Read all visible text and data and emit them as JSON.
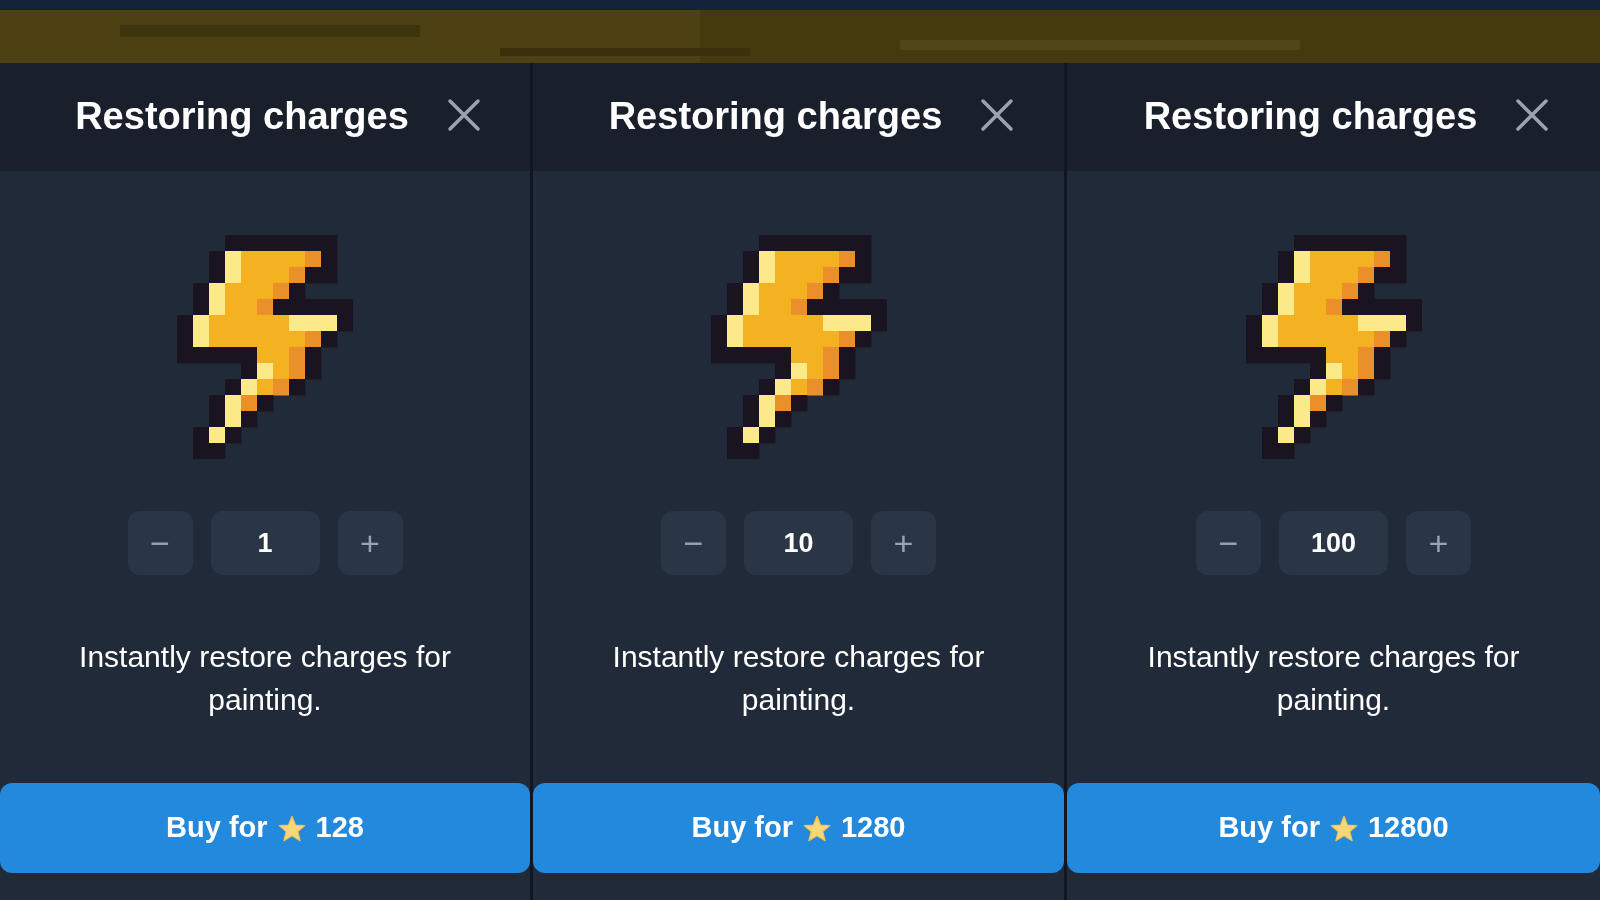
{
  "panels": [
    {
      "title": "Restoring charges",
      "decrement": "−",
      "quantity": "1",
      "increment": "+",
      "description": "Instantly restore charges for painting.",
      "buy_label": "Buy for",
      "price": "128"
    },
    {
      "title": "Restoring charges",
      "decrement": "−",
      "quantity": "10",
      "increment": "+",
      "description": "Instantly restore charges for painting.",
      "buy_label": "Buy for",
      "price": "1280"
    },
    {
      "title": "Restoring charges",
      "decrement": "−",
      "quantity": "100",
      "increment": "+",
      "description": "Instantly restore charges for painting.",
      "buy_label": "Buy for",
      "price": "12800"
    }
  ]
}
